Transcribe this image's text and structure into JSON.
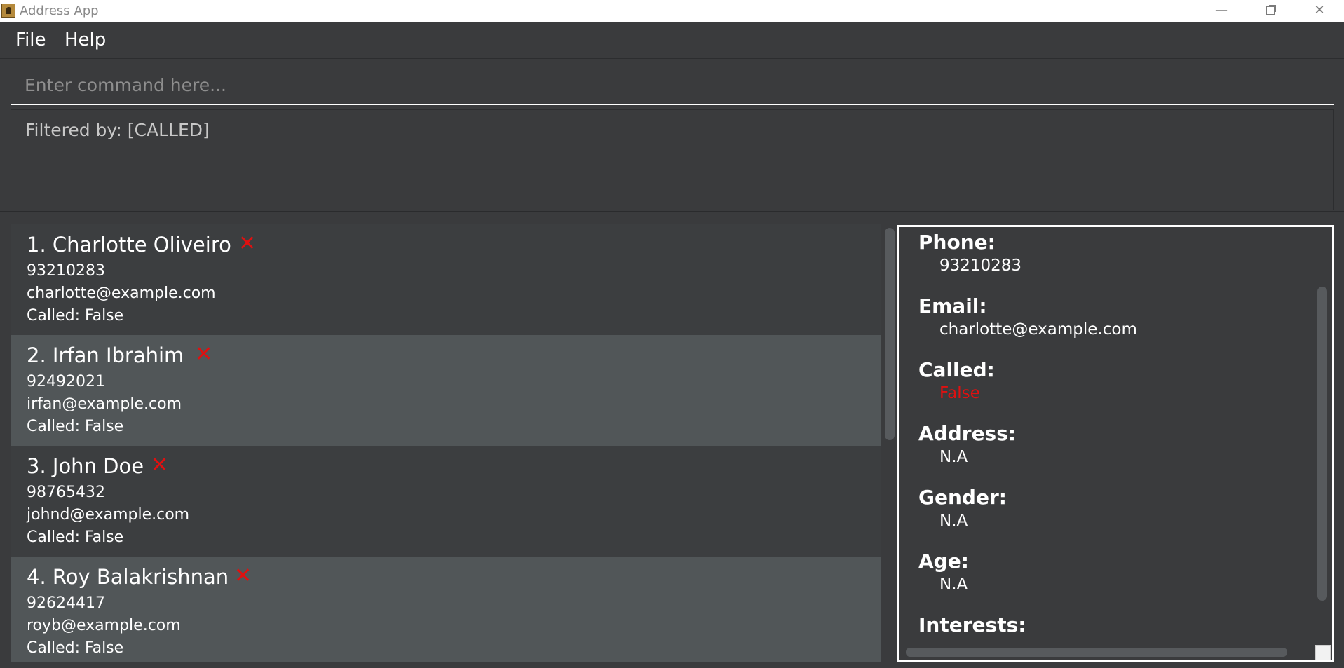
{
  "window": {
    "title": "Address App",
    "minimize_icon": "minimize-icon",
    "maximize_icon": "restore-icon",
    "close_icon": "close-icon"
  },
  "menu": {
    "file": "File",
    "help": "Help"
  },
  "command": {
    "placeholder": "Enter command here..."
  },
  "result": {
    "text": "Filtered by: [CALLED]"
  },
  "persons": [
    {
      "name": "1.  Charlotte Oliveiro",
      "phone": "93210283",
      "email": "charlotte@example.com",
      "called": "Called: False"
    },
    {
      "name": "2.  Irfan Ibrahim",
      "phone": "92492021",
      "email": "irfan@example.com",
      "called": "Called: False"
    },
    {
      "name": "3.  John Doe",
      "phone": "98765432",
      "email": "johnd@example.com",
      "called": "Called: False"
    },
    {
      "name": "4.  Roy Balakrishnan",
      "phone": "92624417",
      "email": "royb@example.com",
      "called": "Called: False"
    }
  ],
  "status_mark": "✕",
  "detail": {
    "phone_label": "Phone:",
    "phone": "93210283",
    "email_label": "Email:",
    "email": "charlotte@example.com",
    "called_label": "Called:",
    "called": "False",
    "address_label": "Address:",
    "address": "N.A",
    "gender_label": "Gender:",
    "gender": "N.A",
    "age_label": "Age:",
    "age": "N.A",
    "interests_label": "Interests:"
  },
  "colors": {
    "background": "#3a3b3d",
    "card_odd": "#3c3e40",
    "card_even": "#515658",
    "not_called_red": "#e01010",
    "text": "#ffffff"
  }
}
